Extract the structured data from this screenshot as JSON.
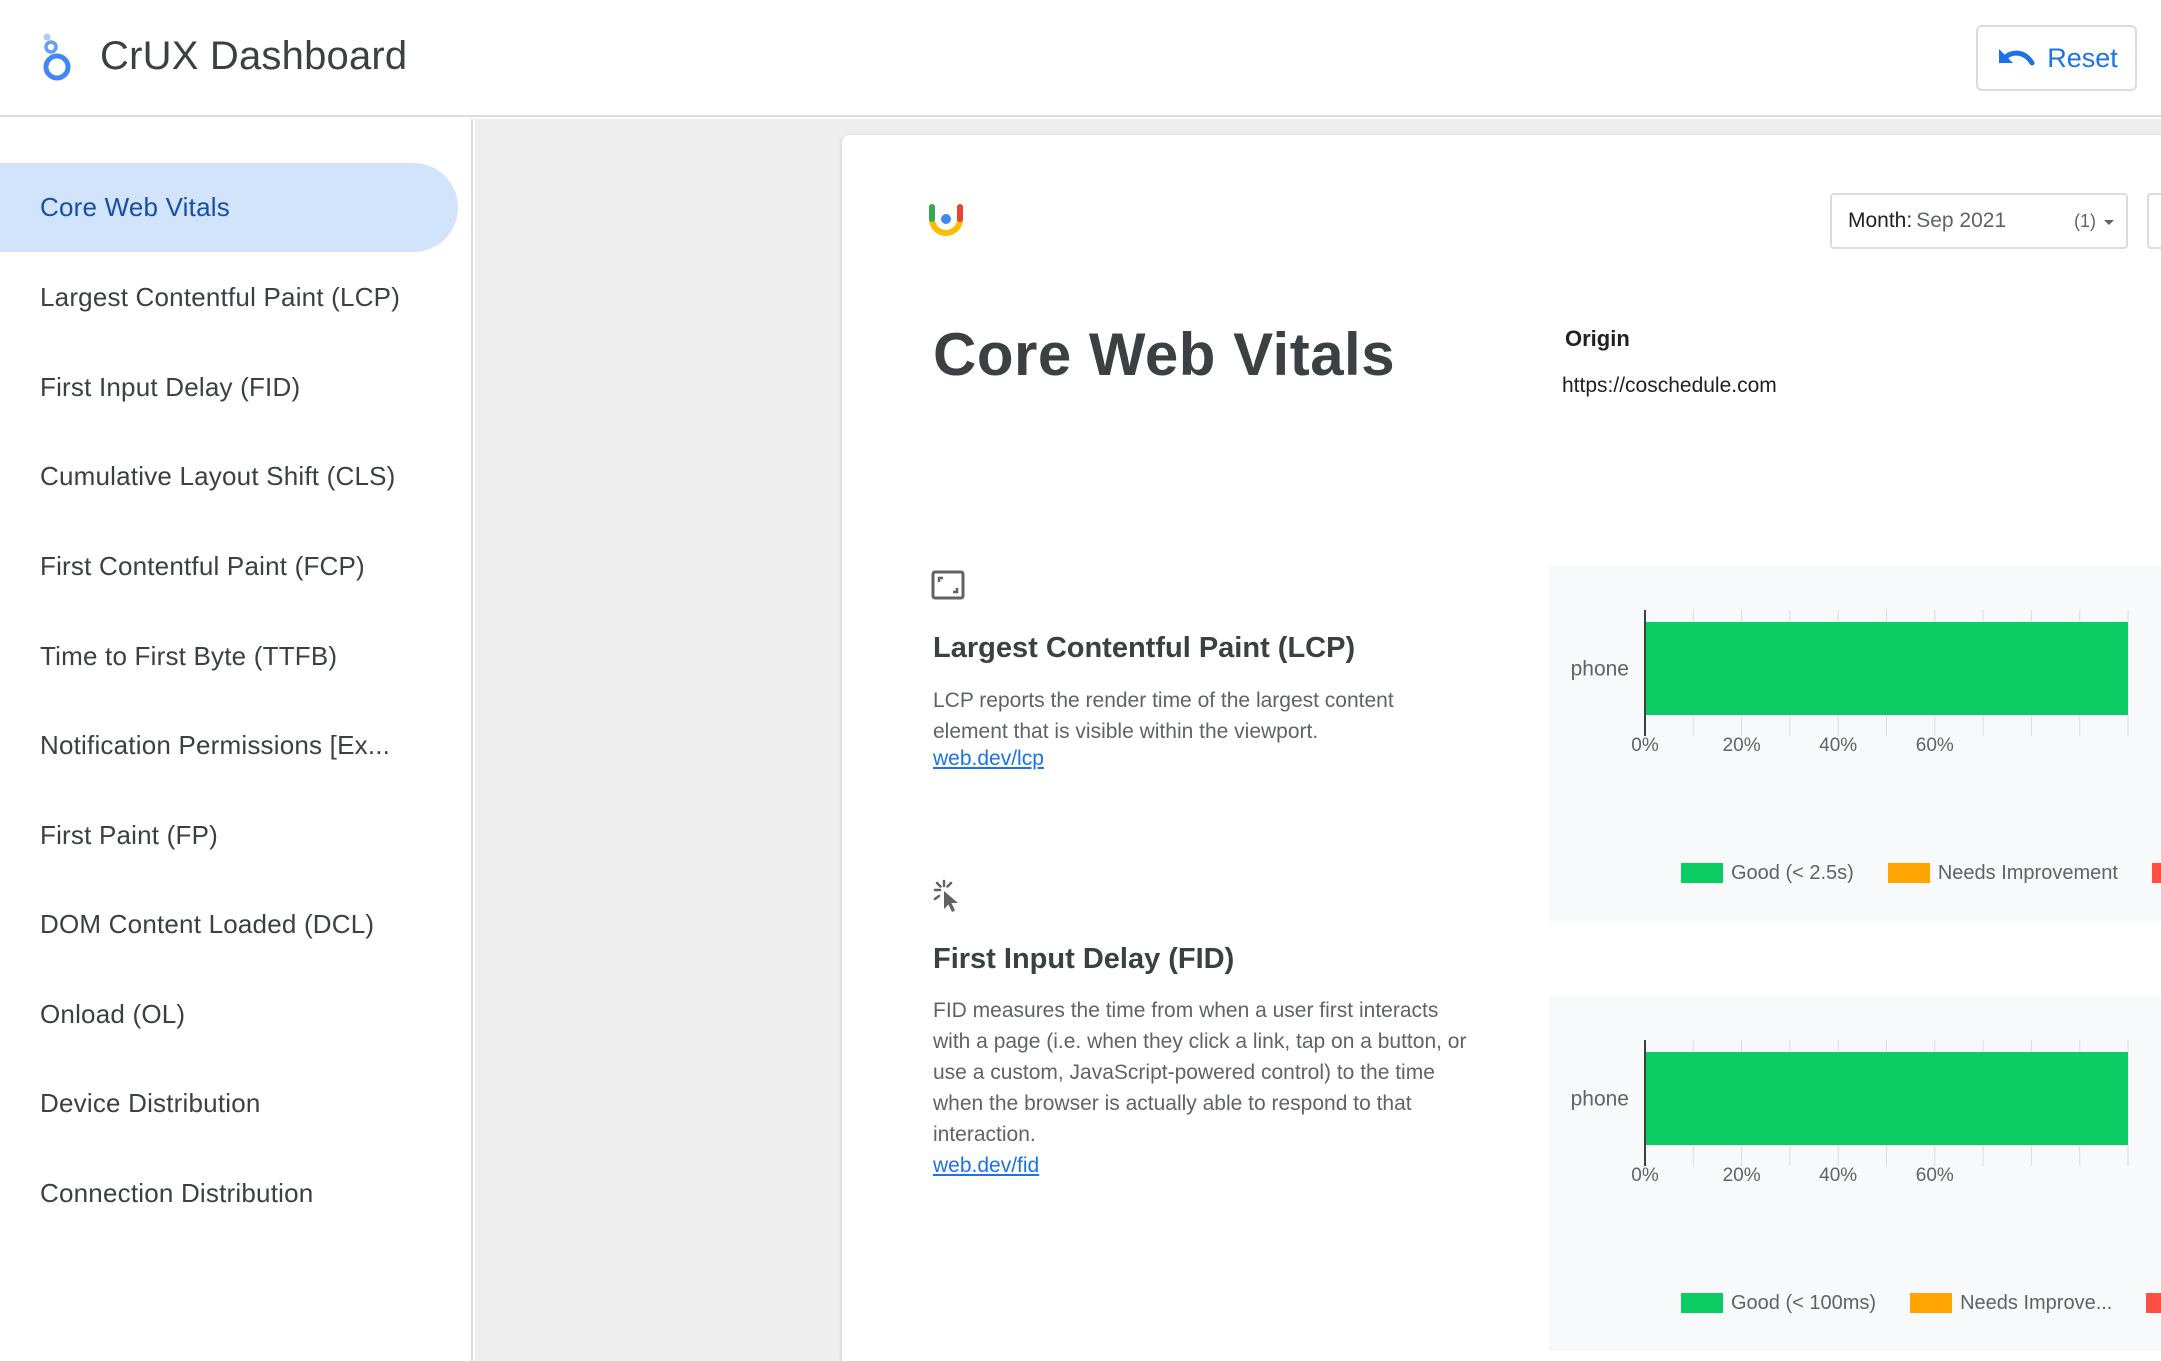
{
  "header": {
    "title": "CrUX Dashboard",
    "reset_label": "Reset"
  },
  "sidebar": {
    "items": [
      {
        "label": "Core Web Vitals",
        "active": true
      },
      {
        "label": "Largest Contentful Paint (LCP)"
      },
      {
        "label": "First Input Delay (FID)"
      },
      {
        "label": "Cumulative Layout Shift (CLS)"
      },
      {
        "label": "First Contentful Paint (FCP)"
      },
      {
        "label": "Time to First Byte (TTFB)"
      },
      {
        "label": "Notification Permissions [Ex..."
      },
      {
        "label": "First Paint (FP)"
      },
      {
        "label": "DOM Content Loaded (DCL)"
      },
      {
        "label": "Onload (OL)"
      },
      {
        "label": "Device Distribution"
      },
      {
        "label": "Connection Distribution"
      }
    ]
  },
  "report": {
    "title": "Core Web Vitals",
    "month_control": {
      "label": "Month:",
      "value": "Sep 2021",
      "count": "(1)"
    },
    "origin_label": "Origin",
    "origin_value": "https://coschedule.com"
  },
  "metrics": [
    {
      "icon": "fullscreen-frame-icon",
      "title": "Largest Contentful Paint (LCP)",
      "description": "LCP reports the render time of the largest content element that is visible within the viewport.",
      "link": "web.dev/lcp"
    },
    {
      "icon": "cursor-click-icon",
      "title": "First Input Delay (FID)",
      "description": "FID measures the time from when a user first interacts with a page (i.e. when they click a link, tap on a button, or use a custom, JavaScript-powered control) to the time when the browser is actually able to respond to that interaction.",
      "link": "web.dev/fid"
    }
  ],
  "colors": {
    "good": "#0ccc64",
    "needs_improvement": "#ffa400",
    "poor": "#ff4e42",
    "accent": "#1a73e8",
    "active_nav_bg": "#d2e3fc"
  },
  "chart_data": [
    {
      "type": "bar",
      "orientation": "horizontal",
      "stacked": true,
      "categories": [
        "phone"
      ],
      "x_ticks": [
        "0%",
        "20%",
        "40%",
        "60%"
      ],
      "xlim": [
        0,
        100
      ],
      "series": [
        {
          "name": "Good (< 2.5s)",
          "color": "#0ccc64",
          "values": [
            100
          ]
        },
        {
          "name": "Needs Improvement",
          "color": "#ffa400",
          "values": [
            0
          ]
        },
        {
          "name": "",
          "color": "#ff4e42",
          "values": [
            0
          ]
        }
      ],
      "legend_position": "bottom"
    },
    {
      "type": "bar",
      "orientation": "horizontal",
      "stacked": true,
      "categories": [
        "phone"
      ],
      "x_ticks": [
        "0%",
        "20%",
        "40%",
        "60%"
      ],
      "xlim": [
        0,
        100
      ],
      "series": [
        {
          "name": "Good (< 100ms)",
          "color": "#0ccc64",
          "values": [
            100
          ]
        },
        {
          "name": "Needs Improve...",
          "color": "#ffa400",
          "values": [
            0
          ]
        },
        {
          "name": "",
          "color": "#ff4e42",
          "values": [
            0
          ]
        }
      ],
      "legend_position": "bottom"
    }
  ]
}
